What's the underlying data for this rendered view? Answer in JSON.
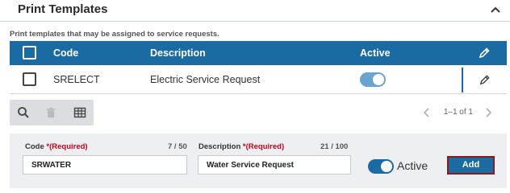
{
  "header": {
    "title": "Print Templates",
    "collapse_icon": "chevron-up-icon"
  },
  "subtitle": "Print templates that may be assigned to service requests.",
  "table": {
    "columns": {
      "code": "Code",
      "description": "Description",
      "active": "Active"
    },
    "rows": [
      {
        "code": "SRELECT",
        "description": "Electric Service Request",
        "active": true
      }
    ]
  },
  "toolbar": {
    "icons": [
      "search-icon",
      "trash-icon",
      "table-view-icon"
    ]
  },
  "pager": {
    "label": "1–1 of 1"
  },
  "form": {
    "code_label": "Code",
    "code_required": "*(Required)",
    "code_counter": "7 / 50",
    "code_value": "SRWATER",
    "description_label": "Description",
    "description_required": "*(Required)",
    "description_counter": "21 / 100",
    "description_value": "Water Service Request",
    "active_label": "Active",
    "active": true,
    "add_label": "Add"
  },
  "colors": {
    "header_blue": "#1a6aa4",
    "required_red": "#d0021b",
    "add_border": "#8c1a1a"
  }
}
